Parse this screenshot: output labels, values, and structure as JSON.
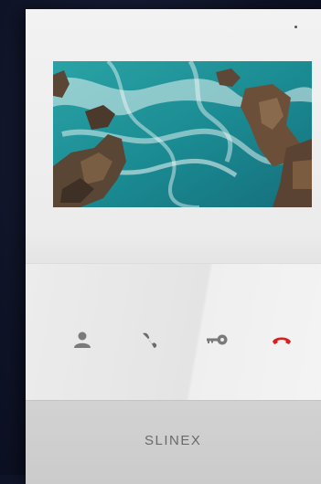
{
  "brand": {
    "logo_text": "SLINEX"
  },
  "display": {
    "image": "coastal-rocks-ocean-photo"
  },
  "controls": [
    {
      "icon": "user-icon",
      "color": "#7a7a7a"
    },
    {
      "icon": "handset-answer-icon",
      "color": "#6a6a6a"
    },
    {
      "icon": "key-icon",
      "color": "#7a7a7a"
    },
    {
      "icon": "hangup-icon",
      "color": "#d62020"
    }
  ],
  "colors": {
    "body": "#ececec",
    "brand_bar": "#cdcdcd",
    "background": "#0f1428",
    "hangup_accent": "#d62020"
  }
}
